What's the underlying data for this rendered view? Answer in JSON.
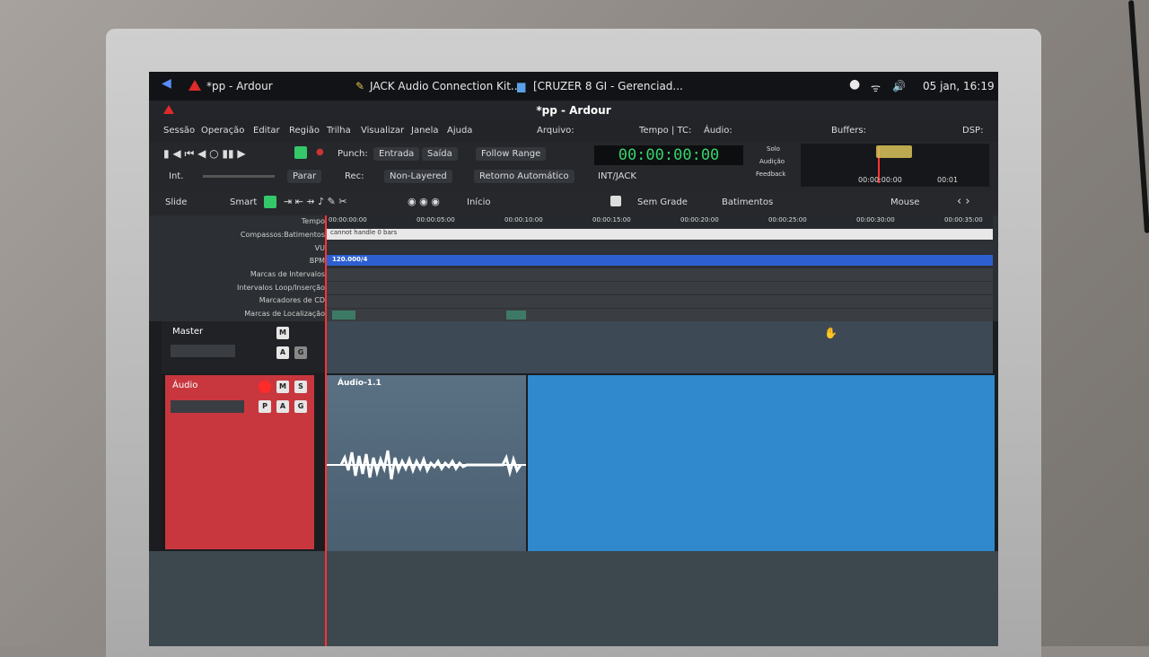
{
  "panel": {
    "tasks": [
      "*pp - Ardour",
      "JACK Audio Connection Kit...",
      "[CRUZER 8 GI - Gerenciad..."
    ],
    "clock": "05 jan, 16:19"
  },
  "window": {
    "title": "*pp - Ardour"
  },
  "menu": [
    "Sessão",
    "Operação",
    "Editar",
    "Região",
    "Trilha",
    "Visualizar",
    "Janela",
    "Ajuda"
  ],
  "status": {
    "arquivo": "Arquivo:",
    "tempo": "Tempo | TC:",
    "audio": "Áudio:",
    "buffers": "Buffers:",
    "dsp": "DSP:"
  },
  "transport": {
    "punch": "Punch:",
    "entrada": "Entrada",
    "saida": "Saída",
    "follow": "Follow Range",
    "clock": "00:00:00:00",
    "int": "Int.",
    "parar": "Parar",
    "rec": "Rec:",
    "nonlayered": "Non-Layered",
    "retorno": "Retorno Automático",
    "intjack": "INT/JACK",
    "solo": "Solo",
    "audicao": "Audição",
    "feedback": "Feedback",
    "mini_time": "00:00:00:00",
    "mini_time2": "00:01"
  },
  "edit": {
    "slide": "Slide",
    "smart": "Smart",
    "inicio": "Início",
    "grade": "Sem Grade",
    "batimentos": "Batimentos",
    "mouse": "Mouse"
  },
  "rulers": {
    "labels": [
      "Tempo",
      "Compassos:Batimentos",
      "VU",
      "BPM",
      "Marcas de Intervalos",
      "Intervalos Loop/Inserção",
      "Marcadores de CD",
      "Marcas de Localização"
    ],
    "ticks": [
      "00:00:00:00",
      "00:00:05:00",
      "00:00:10:00",
      "00:00:15:00",
      "00:00:20:00",
      "00:00:25:00",
      "00:00:30:00",
      "00:00:35:00"
    ],
    "bars_msg": "cannot handle 0 bars",
    "bpm": "120.000/4"
  },
  "tracks": {
    "master": "Master",
    "audio": "Áudio",
    "region": "Áudio-1.1",
    "m": "M",
    "s": "S",
    "a": "A",
    "g": "G",
    "p": "P"
  }
}
